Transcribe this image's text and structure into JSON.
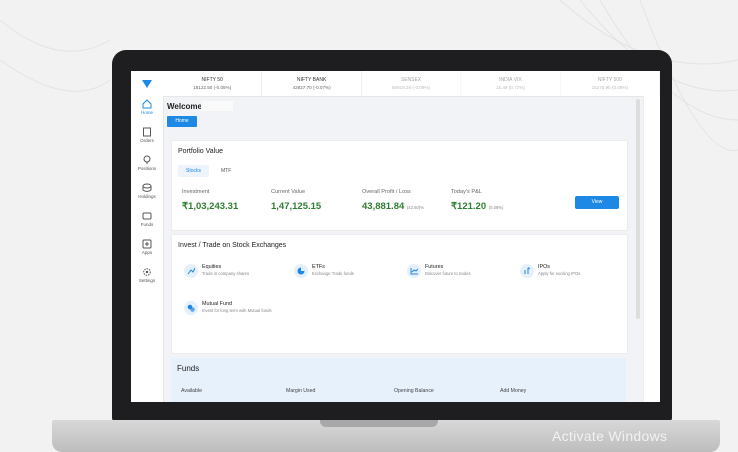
{
  "ticker": [
    {
      "name": "NIFTY 50",
      "value": "18122.50 (-0.05%)",
      "dim": false
    },
    {
      "name": "NIFTY BANK",
      "value": "42827.70 (-0.07%)",
      "dim": false
    },
    {
      "name": "SENSEX",
      "value": "60918.28 (-0.09%)",
      "dim": true
    },
    {
      "name": "INDIA VIX",
      "value": "15.49 (0.72%)",
      "dim": true
    },
    {
      "name": "NIFTY 500",
      "value": "15270.95 (0.09%)",
      "dim": true
    }
  ],
  "sidebar": [
    {
      "label": "Home",
      "icon": "home-icon"
    },
    {
      "label": "Orders",
      "icon": "orders-icon"
    },
    {
      "label": "Positions",
      "icon": "positions-icon"
    },
    {
      "label": "Holdings",
      "icon": "holdings-icon"
    },
    {
      "label": "Funds",
      "icon": "funds-icon"
    },
    {
      "label": "Apps",
      "icon": "apps-icon"
    },
    {
      "label": "Settings",
      "icon": "settings-icon"
    }
  ],
  "welcome": "Welcome,",
  "home_button": "Home",
  "portfolio": {
    "title": "Portfolio Value",
    "tabs": [
      "Stocks",
      "MTF"
    ],
    "investment_label": "Investment",
    "investment": "₹1,03,243.31",
    "current_label": "Current Value",
    "current": "1,47,125.15",
    "profit_label": "Overall Profit / Loss",
    "profit": "43,881.84",
    "profit_pct": "(42.50)%",
    "pnl_label": "Today's P&L",
    "pnl": "₹121.20",
    "pnl_pct": "(0.08%)",
    "view_button": "View"
  },
  "invest": {
    "title": "Invest / Trade on Stock Exchanges",
    "items": [
      {
        "title": "Equities",
        "sub": "Trade in company shares",
        "icon": "equities-icon"
      },
      {
        "title": "ETFs",
        "sub": "Exchange Trade funds",
        "icon": "etf-pie-icon"
      },
      {
        "title": "Futures",
        "sub": "Discover future to trades",
        "icon": "futures-chart-icon"
      },
      {
        "title": "IPOs",
        "sub": "Apply for exciting IPOs",
        "icon": "ipo-icon"
      },
      {
        "title": "Mutual Fund",
        "sub": "Invest for long term with Mutual funds",
        "icon": "mutual-fund-icon"
      }
    ]
  },
  "funds": {
    "title": "Funds",
    "cols": [
      "Available",
      "Margin Used",
      "Opening Balance",
      "Add Money"
    ]
  },
  "watermark": "Activate Windows",
  "colors": {
    "accent": "#1e88e5",
    "profit": "#2e7d32"
  }
}
